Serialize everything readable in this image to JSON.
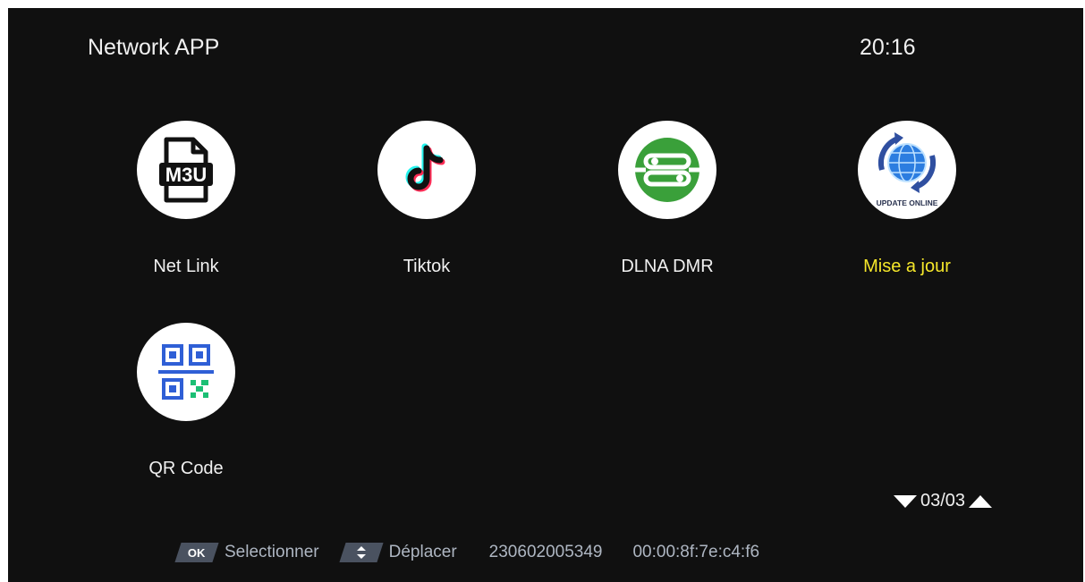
{
  "header": {
    "title": "Network APP",
    "clock": "20:16"
  },
  "apps": [
    {
      "label": "Net Link",
      "icon": "m3u-file-icon",
      "selected": false
    },
    {
      "label": "Tiktok",
      "icon": "tiktok-icon",
      "selected": false
    },
    {
      "label": "DLNA DMR",
      "icon": "dlna-icon",
      "selected": false
    },
    {
      "label": "Mise a jour",
      "icon": "update-online-icon",
      "selected": true,
      "icon_text": "UPDATE ONLINE"
    },
    {
      "label": "QR Code",
      "icon": "qr-code-icon",
      "selected": false
    }
  ],
  "m3u_icon_text": "M3U",
  "pager": {
    "text": "03/03"
  },
  "footer": {
    "ok_key": "OK",
    "ok_label": "Selectionner",
    "move_label": "Déplacer",
    "serial": "230602005349",
    "mac": "00:00:8f:7e:c4:f6"
  },
  "colors": {
    "background": "#101010",
    "text": "#f0f0f0",
    "selected": "#f5e72a",
    "footer_text": "#aeb6c2",
    "key_bg": "#4a5260",
    "dlna_green": "#3aa03a",
    "qr_blue": "#2f5fd6",
    "qr_green": "#1bbf74"
  }
}
